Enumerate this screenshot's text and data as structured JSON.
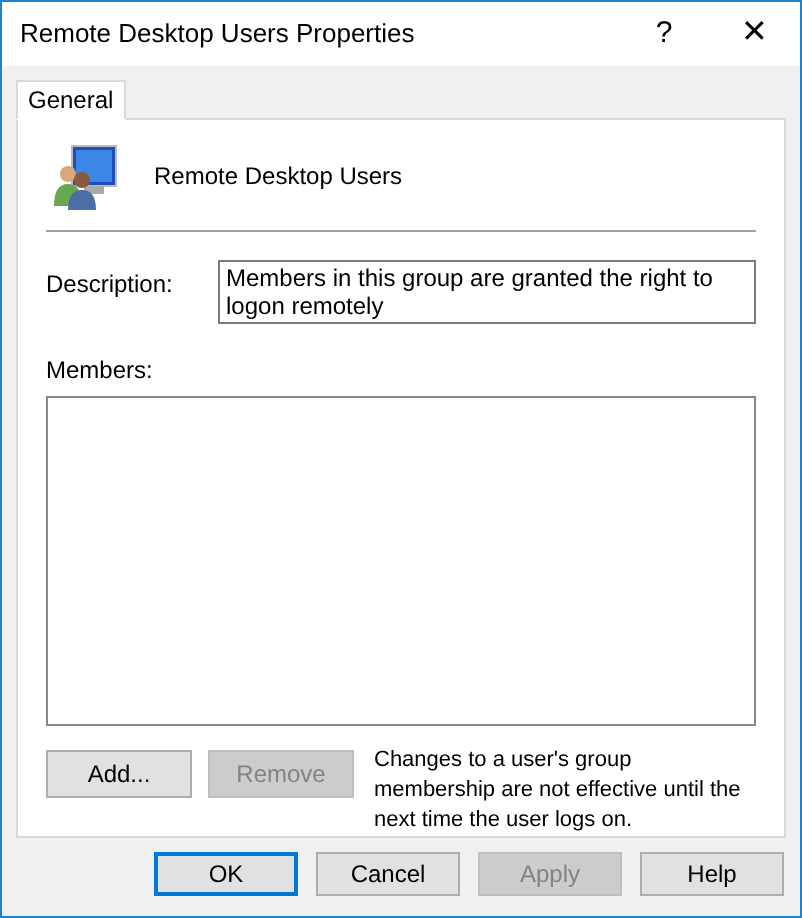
{
  "window": {
    "title": "Remote Desktop Users Properties",
    "help_glyph": "?",
    "close_glyph": "✕"
  },
  "tabs": [
    {
      "label": "General",
      "selected": true
    }
  ],
  "group": {
    "name": "Remote Desktop Users"
  },
  "description": {
    "label": "Description:",
    "value": "Members in this group are granted the right to logon remotely"
  },
  "members": {
    "label": "Members:"
  },
  "member_buttons": [
    {
      "label": "Add...",
      "disabled": false
    },
    {
      "label": "Remove",
      "disabled": true
    }
  ],
  "note": "Changes to a user's group membership are not effective until the next time the user logs on.",
  "buttons": [
    {
      "label": "OK",
      "default": true,
      "disabled": false
    },
    {
      "label": "Cancel",
      "default": false,
      "disabled": false
    },
    {
      "label": "Apply",
      "default": false,
      "disabled": true
    },
    {
      "label": "Help",
      "default": false,
      "disabled": false
    }
  ]
}
